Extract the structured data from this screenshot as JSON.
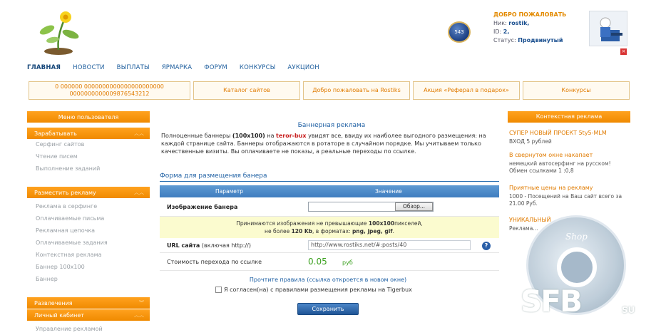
{
  "header": {
    "welcome_title": "ДОБРО ПОЖАЛОВАТЬ",
    "nick_label": "Ник:",
    "nick_value": "rostik,",
    "id_label": "ID:",
    "id_value": "2,",
    "status_label": "Статус:",
    "status_value": "Продвинутый",
    "coin_value": "543"
  },
  "nav": [
    "ГЛАВНАЯ",
    "НОВОСТИ",
    "ВЫПЛАТЫ",
    "ЯРМАРКА",
    "ФОРУМ",
    "КОНКУРСЫ",
    "АУКЦИОН"
  ],
  "promo": [
    "0 000000 0000000000000000000000 0000000000009876543212",
    "Каталог сайтов",
    "Добро пожаловать на Rostiks",
    "Акция «Реферал в подарок»",
    "Конкурсы"
  ],
  "sidebar": {
    "menu_title": "Меню пользователя",
    "earn": "Зарабатывать",
    "earn_items": [
      "Серфинг сайтов",
      "Чтение писем",
      "Выполнение заданий"
    ],
    "advertise": "Разместить рекламу",
    "advertise_items": [
      "Реклама в серфинге",
      "Оплачиваемые письма",
      "Рекламная цепочка",
      "Оплачиваемые задания",
      "Контекстная реклама",
      "Баннер 100х100",
      "Баннер"
    ],
    "entertainment": "Развлечения",
    "cabinet": "Личный кабинет",
    "cabinet_items": [
      "Управление рекламой"
    ]
  },
  "main": {
    "title": "Баннерная реклама",
    "text_1": "Полноценные баннеры ",
    "text_size": "(100х100)",
    "text_2": " на ",
    "text_site": "teror-bux",
    "text_3": " увидят все, ввиду их наиболее выгодного размещения: на каждой странице сайта. Баннеры отображаются в ротаторе в случайном порядке. Мы учитываем только качественные визиты. Вы оплачиваете не показы, а реальные переходы по ссылке.",
    "form_title": "Форма для размещения банера",
    "col_param": "Параметр",
    "col_value": "Значение",
    "image_label": "Изображение банера",
    "browse_button": "Обзор...",
    "notice_1": "Принимаются изображения не превышающие ",
    "notice_size": "100х100",
    "notice_2": "пикселей,",
    "notice_3": "не более ",
    "notice_kb": "120 Kb",
    "notice_4": ", в форматах: ",
    "notice_fmt": "png, jpeg, gif",
    "notice_5": ".",
    "url_label": "URL сайта",
    "url_hint": " (включая http://)",
    "url_value": "http://www.rostiks.net/#:posts/40",
    "cost_label": "Стоимость перехода по ссылке",
    "cost_value": "0.05",
    "cost_unit": "руб",
    "rules_text": "Прочтите правила (ссылка откроется в новом окне)",
    "agree_text": "Я согласен(на) с правилами размещения рекламы на Tigerbux",
    "save_button": "Сохранить"
  },
  "right": {
    "title": "Контекстная реклама",
    "ads": [
      {
        "title": "СУПЕР НОВЫЙ ПРОЕКТ 5ty5-MLM",
        "text": "ВХОД 5 рублей"
      },
      {
        "title": "В свернутом окне накапает",
        "text": "немецкий автосерфинг на русском! Обмен ссылками 1 :0,8"
      },
      {
        "title": "Приятные цены на рекламу",
        "text": "1000 - Посещений на Ваш сайт всего за 21.00 Руб."
      },
      {
        "title": "УНИКАЛЬНЫЙ",
        "text": "Реклама..."
      }
    ]
  },
  "watermark": {
    "shop": "Shop",
    "brand": "SFB",
    "suffix": "SU"
  },
  "colors": {
    "accent": "#f08a00",
    "link": "#1f5f9e",
    "green": "#3aa01e"
  }
}
